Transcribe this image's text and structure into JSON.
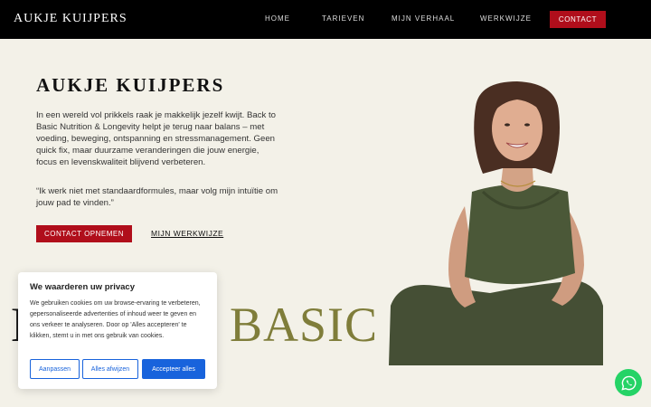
{
  "header": {
    "brand": "AUKJE KUIJPERS",
    "nav": [
      "HOME",
      "TARIEVEN",
      "MIJN VERHAAL",
      "WERKWIJZE"
    ],
    "contact": "CONTACT"
  },
  "hero": {
    "title": "AUKJE KUIJPERS",
    "intro": "In een wereld vol prikkels raak je makkelijk jezelf kwijt. Back to Basic Nutrition & Longevity helpt je terug naar balans – met voeding, beweging, ontspanning en stressmanagement. Geen quick fix, maar duurzame veranderingen die jouw energie, focus en levenskwaliteit blijvend verbeteren.",
    "quote": "“Ik werk niet met standaardformules, maar volg mijn intuïtie om jouw pad te vinden.”",
    "cta_primary": "CONTACT OPNEMEN",
    "cta_secondary": "MIJN WERKWIJZE",
    "big_left": "B",
    "big_word": "BASIC"
  },
  "cookie": {
    "title": "We waarderen uw privacy",
    "text": "We gebruiken cookies om uw browse-ervaring te verbeteren, gepersonaliseerde advertenties of inhoud weer te geven en ons verkeer te analyseren. Door op 'Alles accepteren' te klikken, stemt u in met ons gebruik van cookies.",
    "btn_customize": "Aanpassen",
    "btn_reject": "Alles afwijzen",
    "btn_accept": "Accepteer alles"
  },
  "colors": {
    "accent": "#b00e1b",
    "olive": "#7f7d3a",
    "cookie_blue": "#1863dc",
    "whatsapp": "#25d366"
  },
  "icons": {
    "whatsapp": "whatsapp-icon"
  }
}
